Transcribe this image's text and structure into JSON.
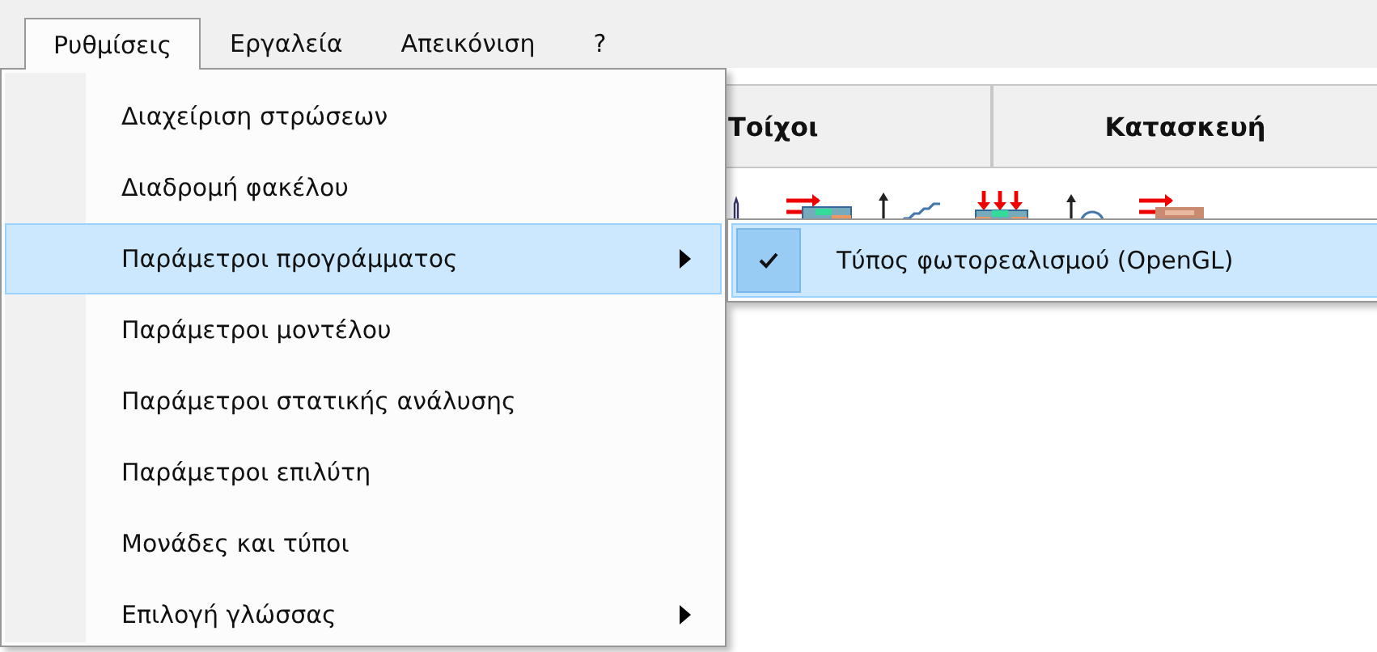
{
  "menubar": [
    {
      "label": "Ρυθμίσεις",
      "selected": true
    },
    {
      "label": "Εργαλεία",
      "selected": false
    },
    {
      "label": "Απεικόνιση",
      "selected": false
    },
    {
      "label": "?",
      "selected": false
    }
  ],
  "tabs": [
    {
      "label": "Τοίχοι"
    },
    {
      "label": "Κατασκευή"
    }
  ],
  "dropdown": [
    {
      "label": "Διαχείριση στρώσεων",
      "selected": false,
      "submenu": false
    },
    {
      "label": "Διαδρομή φακέλου",
      "selected": false,
      "submenu": false
    },
    {
      "label": "Παράμετροι προγράμματος",
      "selected": true,
      "submenu": true
    },
    {
      "label": "Παράμετροι μοντέλου",
      "selected": false,
      "submenu": false
    },
    {
      "label": "Παράμετροι στατικής ανάλυσης",
      "selected": false,
      "submenu": false
    },
    {
      "label": "Παράμετροι επιλύτη",
      "selected": false,
      "submenu": false
    },
    {
      "label": "Μονάδες και τύποι",
      "selected": false,
      "submenu": false
    },
    {
      "label": "Επιλογή γλώσσας",
      "selected": false,
      "submenu": true
    }
  ],
  "submenu": [
    {
      "label": "Τύπος φωτορεαλισμού (OpenGL)",
      "selected": true,
      "checked": true
    }
  ]
}
